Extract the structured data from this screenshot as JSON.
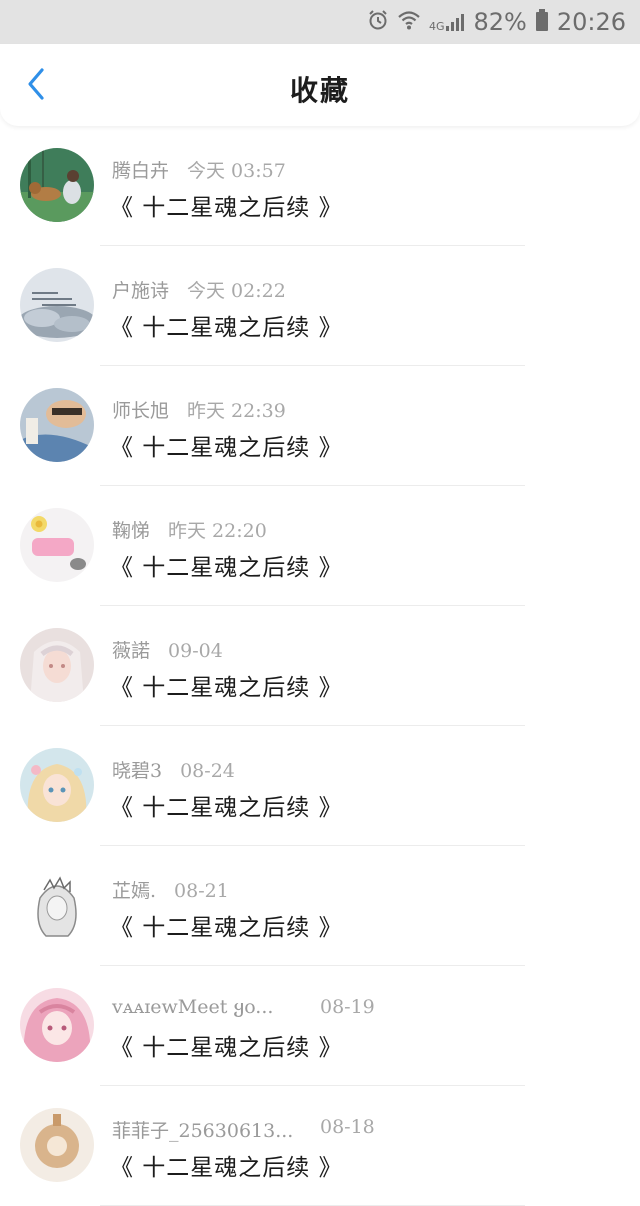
{
  "status_bar": {
    "icons": [
      "alarm-icon",
      "wifi-icon",
      "signal-4g-icon",
      "battery-icon"
    ],
    "network": "4G",
    "battery": "82%",
    "time": "20:26"
  },
  "header": {
    "title": "收藏",
    "back_icon": "chevron-left-icon"
  },
  "colors": {
    "accent": "#2f8fe8",
    "divider": "#ececec",
    "meta_text": "#9a9a9a",
    "status_bar_bg": "#e3e3e3"
  },
  "items": [
    {
      "user": "腾白卉",
      "time": "今天 03:57",
      "article": "《 十二星魂之后续 》"
    },
    {
      "user": "户施诗",
      "time": "今天 02:22",
      "article": "《 十二星魂之后续 》"
    },
    {
      "user": "师长旭",
      "time": "昨天 22:39",
      "article": "《 十二星魂之后续 》"
    },
    {
      "user": "鞠悌",
      "time": "昨天 22:20",
      "article": "《 十二星魂之后续 》"
    },
    {
      "user": "薇諾",
      "time": "09-04",
      "article": "《 十二星魂之后续 》"
    },
    {
      "user": "晓碧3",
      "time": "08-24",
      "article": "《 十二星魂之后续 》"
    },
    {
      "user": "芷嫣.",
      "time": "08-21",
      "article": "《 十二星魂之后续 》"
    },
    {
      "user": "ᴠᴀᴀɪewMeet ყo...",
      "time": "08-19",
      "article": "《 十二星魂之后续 》"
    },
    {
      "user": "菲菲子_25630613...",
      "time": "08-18",
      "article": "《 十二星魂之后续 》"
    }
  ]
}
